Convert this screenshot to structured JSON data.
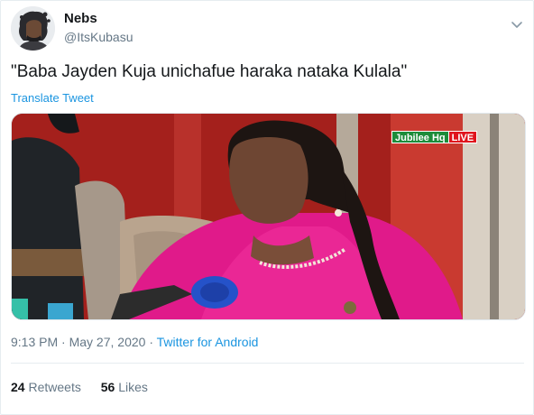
{
  "user": {
    "name": "Nebs",
    "handle": "@ItsKubasu"
  },
  "tweet": {
    "text": "\"Baba Jayden Kuja unichafue haraka nataka Kulala\"",
    "translate_label": "Translate Tweet"
  },
  "media": {
    "channel_bug": "Jubilee Hq",
    "live_label": "LIVE"
  },
  "meta": {
    "time": "9:13 PM",
    "separator": " · ",
    "date": "May 27, 2020",
    "source": "Twitter for Android"
  },
  "stats": {
    "retweets_count": "24",
    "retweets_label": "Retweets",
    "likes_count": "56",
    "likes_label": "Likes"
  },
  "colors": {
    "link": "#1b95e0",
    "secondary_text": "#657786",
    "primary_text": "#14171a"
  }
}
